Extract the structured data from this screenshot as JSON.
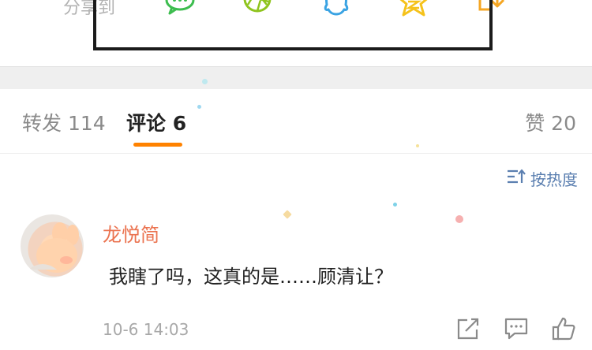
{
  "share": {
    "label": "分享到",
    "icons": [
      "wechat-icon",
      "moments-icon",
      "qq-icon",
      "qzone-icon",
      "download-icon"
    ]
  },
  "tabs": {
    "repost": "转发 114",
    "comments": "评论 6",
    "likes": "赞 20"
  },
  "sort": {
    "label": "按热度",
    "icon": "sort-icon"
  },
  "comment": {
    "username": "龙悦简",
    "text": "我瞎了吗，这真的是……顾清让？",
    "time": "10-6 14:03"
  },
  "colors": {
    "accent": "#ff8200",
    "username": "#eb7350",
    "sort": "#5b7fb0",
    "wechat": "#3dbd4f",
    "moments": "#8fc41f",
    "qq": "#3aa3e3",
    "qzone": "#f5c21b",
    "download": "#f5a623"
  }
}
